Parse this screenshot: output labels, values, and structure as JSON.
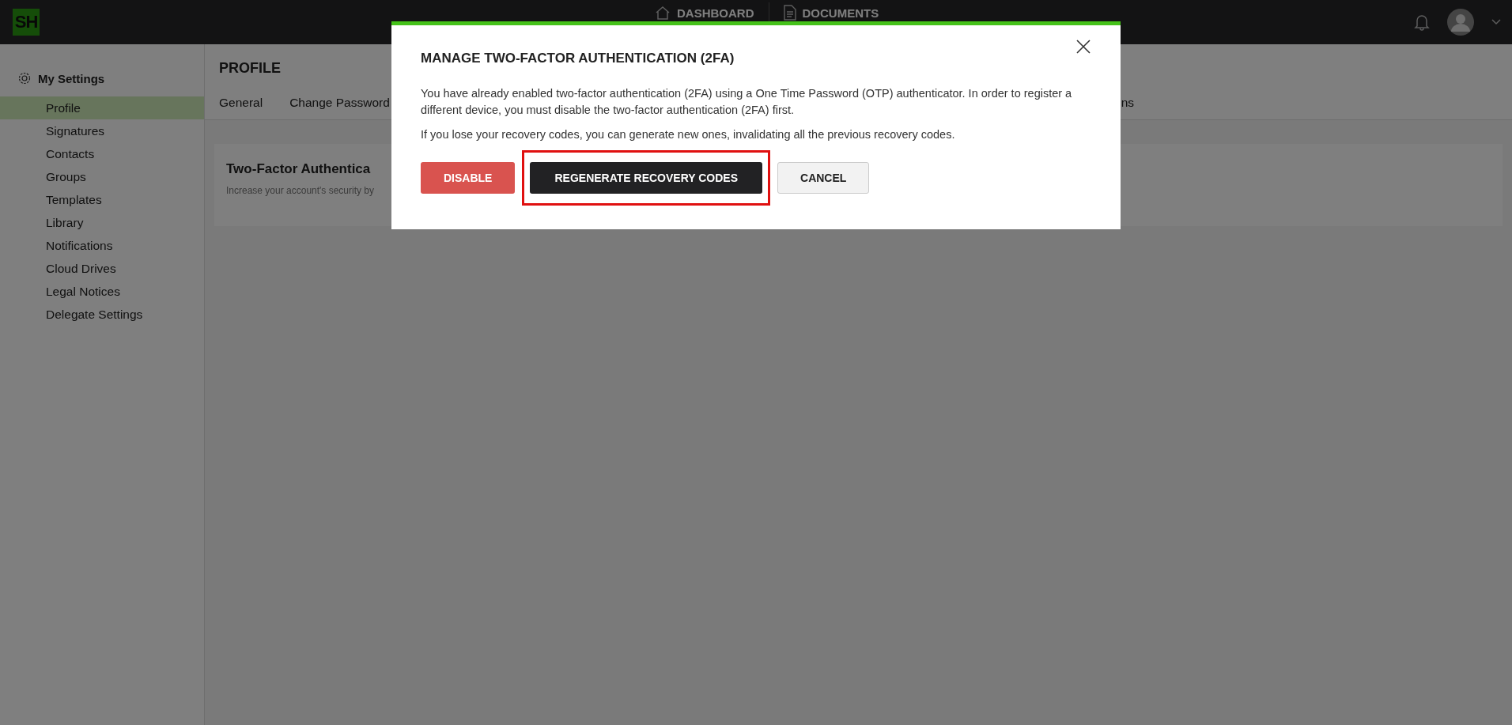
{
  "topbar": {
    "logo": "SH",
    "nav": [
      {
        "label": "DASHBOARD",
        "kind": "home"
      },
      {
        "label": "DOCUMENTS",
        "kind": "document"
      }
    ]
  },
  "sidebar": {
    "title": "My Settings",
    "items": [
      {
        "label": "Profile",
        "selected": true
      },
      {
        "label": "Signatures",
        "selected": false
      },
      {
        "label": "Contacts",
        "selected": false
      },
      {
        "label": "Groups",
        "selected": false
      },
      {
        "label": "Templates",
        "selected": false
      },
      {
        "label": "Library",
        "selected": false
      },
      {
        "label": "Notifications",
        "selected": false
      },
      {
        "label": "Cloud Drives",
        "selected": false
      },
      {
        "label": "Legal Notices",
        "selected": false
      },
      {
        "label": "Delegate Settings",
        "selected": false
      }
    ]
  },
  "page": {
    "title": "PROFILE",
    "tabs": [
      "General",
      "Change Password",
      "ns"
    ],
    "card": {
      "title": "Two-Factor Authentica",
      "subtitle": "Increase your account's security by"
    }
  },
  "dialog": {
    "title": "MANAGE TWO-FACTOR AUTHENTICATION (2FA)",
    "paragraphs": [
      "You have already enabled two-factor authentication (2FA) using a One Time Password (OTP) authenticator. In order to register a different device, you must disable the two-factor authentication (2FA) first.",
      "If you lose your recovery codes, you can generate new ones, invalidating all the previous recovery codes."
    ],
    "buttons": [
      {
        "label": "DISABLE",
        "kind": "danger",
        "highlighted": false
      },
      {
        "label": "REGENERATE RECOVERY CODES",
        "kind": "primary",
        "highlighted": true
      },
      {
        "label": "CANCEL",
        "kind": "secondary",
        "highlighted": false
      }
    ]
  }
}
